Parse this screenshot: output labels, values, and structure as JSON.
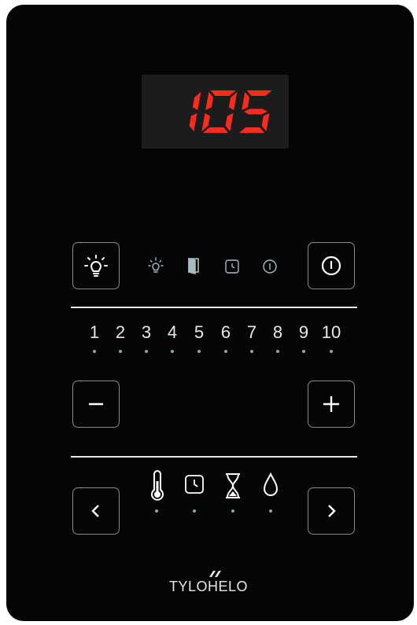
{
  "display": {
    "value": "105",
    "color": "#ff2a1e"
  },
  "levels": [
    "1",
    "2",
    "3",
    "4",
    "5",
    "6",
    "7",
    "8",
    "9",
    "10"
  ],
  "brand": "TYLOHELO",
  "icons": {
    "light_button": "lightbulb-icon",
    "power_button": "power-icon",
    "minus_button": "minus-icon",
    "plus_button": "plus-icon",
    "prev_button": "chevron-left-icon",
    "next_button": "chevron-right-icon",
    "status": [
      "lightbulb-icon",
      "door-icon",
      "clock-icon",
      "info-icon"
    ],
    "modes": [
      "thermometer-icon",
      "clock-icon",
      "hourglass-icon",
      "water-drop-icon"
    ]
  }
}
